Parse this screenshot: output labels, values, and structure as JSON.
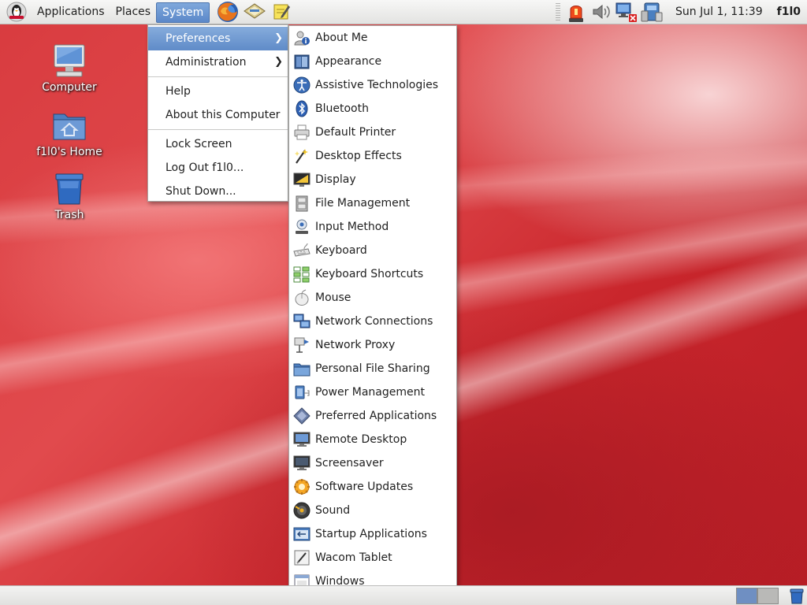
{
  "top_panel": {
    "menus": [
      "Applications",
      "Places",
      "System"
    ],
    "clock": "Sun Jul  1, 11:39",
    "username": "f1l0"
  },
  "desktop": {
    "icons": [
      {
        "label": "Computer",
        "icon": "computer-icon"
      },
      {
        "label": "f1l0's Home",
        "icon": "home-folder-icon"
      },
      {
        "label": "Trash",
        "icon": "trash-icon"
      }
    ]
  },
  "system_menu": {
    "items": [
      {
        "label": "Preferences",
        "submenu": true,
        "highlighted": true
      },
      {
        "label": "Administration",
        "submenu": true
      },
      {
        "label": "Help"
      },
      {
        "label": "About this Computer"
      },
      {
        "label": "Lock Screen"
      },
      {
        "label": "Log Out f1l0..."
      },
      {
        "label": "Shut Down..."
      }
    ]
  },
  "preferences_menu": {
    "items": [
      {
        "label": "About Me",
        "icon": "about-me-icon"
      },
      {
        "label": "Appearance",
        "icon": "appearance-icon"
      },
      {
        "label": "Assistive Technologies",
        "icon": "accessibility-icon"
      },
      {
        "label": "Bluetooth",
        "icon": "bluetooth-icon"
      },
      {
        "label": "Default Printer",
        "icon": "printer-icon"
      },
      {
        "label": "Desktop Effects",
        "icon": "desktop-effects-icon"
      },
      {
        "label": "Display",
        "icon": "display-icon"
      },
      {
        "label": "File Management",
        "icon": "file-management-icon"
      },
      {
        "label": "Input Method",
        "icon": "input-method-icon"
      },
      {
        "label": "Keyboard",
        "icon": "keyboard-icon"
      },
      {
        "label": "Keyboard Shortcuts",
        "icon": "keyboard-shortcuts-icon"
      },
      {
        "label": "Mouse",
        "icon": "mouse-icon"
      },
      {
        "label": "Network Connections",
        "icon": "network-connections-icon"
      },
      {
        "label": "Network Proxy",
        "icon": "network-proxy-icon"
      },
      {
        "label": "Personal File Sharing",
        "icon": "file-sharing-icon"
      },
      {
        "label": "Power Management",
        "icon": "power-management-icon"
      },
      {
        "label": "Preferred Applications",
        "icon": "preferred-applications-icon"
      },
      {
        "label": "Remote Desktop",
        "icon": "remote-desktop-icon"
      },
      {
        "label": "Screensaver",
        "icon": "screensaver-icon"
      },
      {
        "label": "Software Updates",
        "icon": "software-updates-icon"
      },
      {
        "label": "Sound",
        "icon": "sound-icon"
      },
      {
        "label": "Startup Applications",
        "icon": "startup-applications-icon"
      },
      {
        "label": "Wacom Tablet",
        "icon": "wacom-tablet-icon"
      },
      {
        "label": "Windows",
        "icon": "windows-icon"
      }
    ]
  },
  "colors": {
    "menu_highlight": "#5f8bc8",
    "panel_bg": "#e9e9e7",
    "desktop_red": "#d83b3f"
  }
}
